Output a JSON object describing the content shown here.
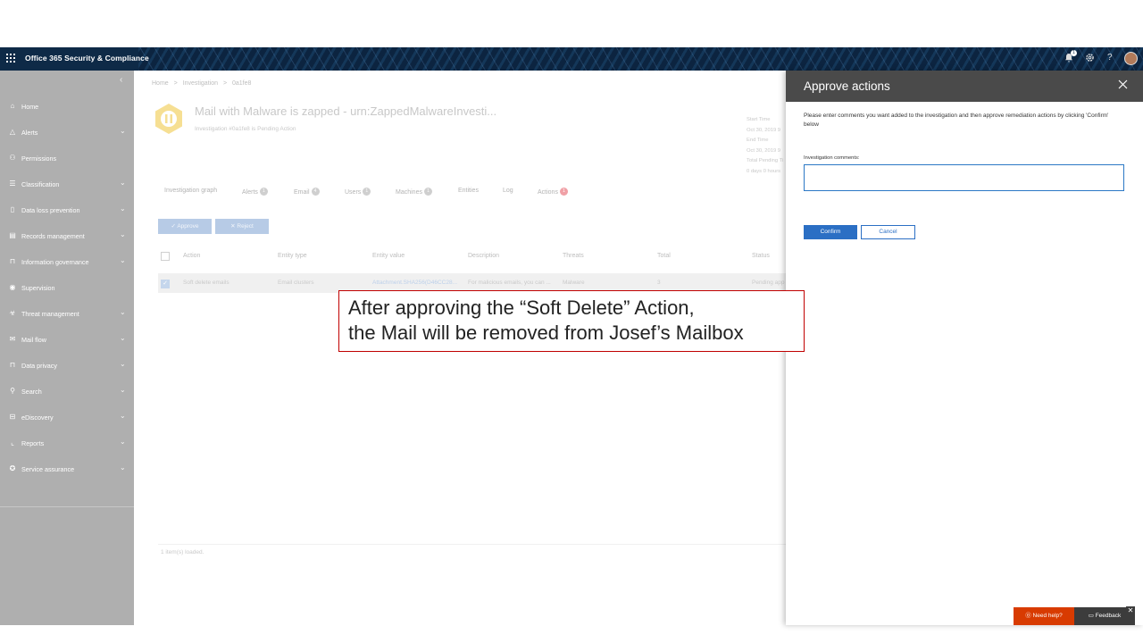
{
  "topbar": {
    "app_title": "Office 365 Security & Compliance",
    "waffle_icon": "waffle-icon",
    "notification_count": "1",
    "icons": [
      "bell-icon",
      "gear-icon",
      "help-icon",
      "avatar"
    ]
  },
  "sidebar": {
    "collapse_icon": "chevron-left-icon",
    "items": [
      {
        "label": "Home",
        "icon": "home-icon",
        "expandable": false
      },
      {
        "label": "Alerts",
        "icon": "alert-icon",
        "expandable": true
      },
      {
        "label": "Permissions",
        "icon": "people-icon",
        "expandable": false
      },
      {
        "label": "Classification",
        "icon": "list-icon",
        "expandable": true
      },
      {
        "label": "Data loss prevention",
        "icon": "document-shield-icon",
        "expandable": true
      },
      {
        "label": "Records management",
        "icon": "records-icon",
        "expandable": true
      },
      {
        "label": "Information governance",
        "icon": "lock-icon",
        "expandable": true
      },
      {
        "label": "Supervision",
        "icon": "eye-icon",
        "expandable": false
      },
      {
        "label": "Threat management",
        "icon": "biohazard-icon",
        "expandable": true
      },
      {
        "label": "Mail flow",
        "icon": "mail-icon",
        "expandable": true
      },
      {
        "label": "Data privacy",
        "icon": "lock-icon",
        "expandable": true
      },
      {
        "label": "Search",
        "icon": "search-icon",
        "expandable": true
      },
      {
        "label": "eDiscovery",
        "icon": "ediscovery-icon",
        "expandable": true
      },
      {
        "label": "Reports",
        "icon": "chart-icon",
        "expandable": true
      },
      {
        "label": "Service assurance",
        "icon": "ribbon-icon",
        "expandable": true
      }
    ]
  },
  "main": {
    "breadcrumb": [
      "Home",
      ">",
      "Investigation",
      ">",
      "0a1fe8"
    ],
    "title": "Mail with Malware is zapped - urn:ZappedMalwareInvesti...",
    "subtitle": "Investigation #0a1fe8 is Pending Action",
    "time_info": {
      "start_label": "Start Time",
      "start_value": "Oct 30, 2019 9",
      "end_label": "End Time",
      "end_value": "Oct 30, 2019 9",
      "pending_label": "Total Pending Ti",
      "pending_value": "0 days 0 hours"
    },
    "tabs": [
      {
        "label": "Investigation graph",
        "badge": ""
      },
      {
        "label": "Alerts",
        "badge": "1"
      },
      {
        "label": "Email",
        "badge": "4"
      },
      {
        "label": "Users",
        "badge": "1"
      },
      {
        "label": "Machines",
        "badge": "1"
      },
      {
        "label": "Entities",
        "badge": ""
      },
      {
        "label": "Log",
        "badge": ""
      },
      {
        "label": "Actions",
        "badge": "1"
      }
    ],
    "approve_label": "✓ Approve",
    "reject_label": "✕ Reject",
    "columns": [
      "Action",
      "Entity type",
      "Entity value",
      "Description",
      "Threats",
      "Total",
      "Status"
    ],
    "rows": [
      {
        "action": "Soft delete emails",
        "entity_type": "Email clusters",
        "entity_value": "Attachment.SHA256(D46CC28...",
        "description": "For malicious emails, you can ...",
        "threats": "Malware",
        "total": "3",
        "status": "Pending app"
      }
    ],
    "loaded_text": "1 item(s) loaded."
  },
  "panel": {
    "title": "Approve actions",
    "description": "Please enter comments you want added to the investigation and then approve remediation actions by clicking 'Confirm' below",
    "comments_label": "Investigation comments:",
    "comments_value": "",
    "confirm_label": "Confirm",
    "cancel_label": "Cancel"
  },
  "callout": {
    "line1": "After approving the “Soft Delete” Action,",
    "line2": "the Mail will be removed from Josef’s Mailbox"
  },
  "helpbar": {
    "need_help_label": "⓪ Need help?",
    "feedback_label": "Feedback"
  },
  "colors": {
    "topbar": "#0e2a47",
    "sidebar": "#afafaf",
    "panel_header": "#4a4a4a",
    "primary": "#2b6fc4",
    "callout_border": "#c00000",
    "need_help": "#d83b01"
  }
}
